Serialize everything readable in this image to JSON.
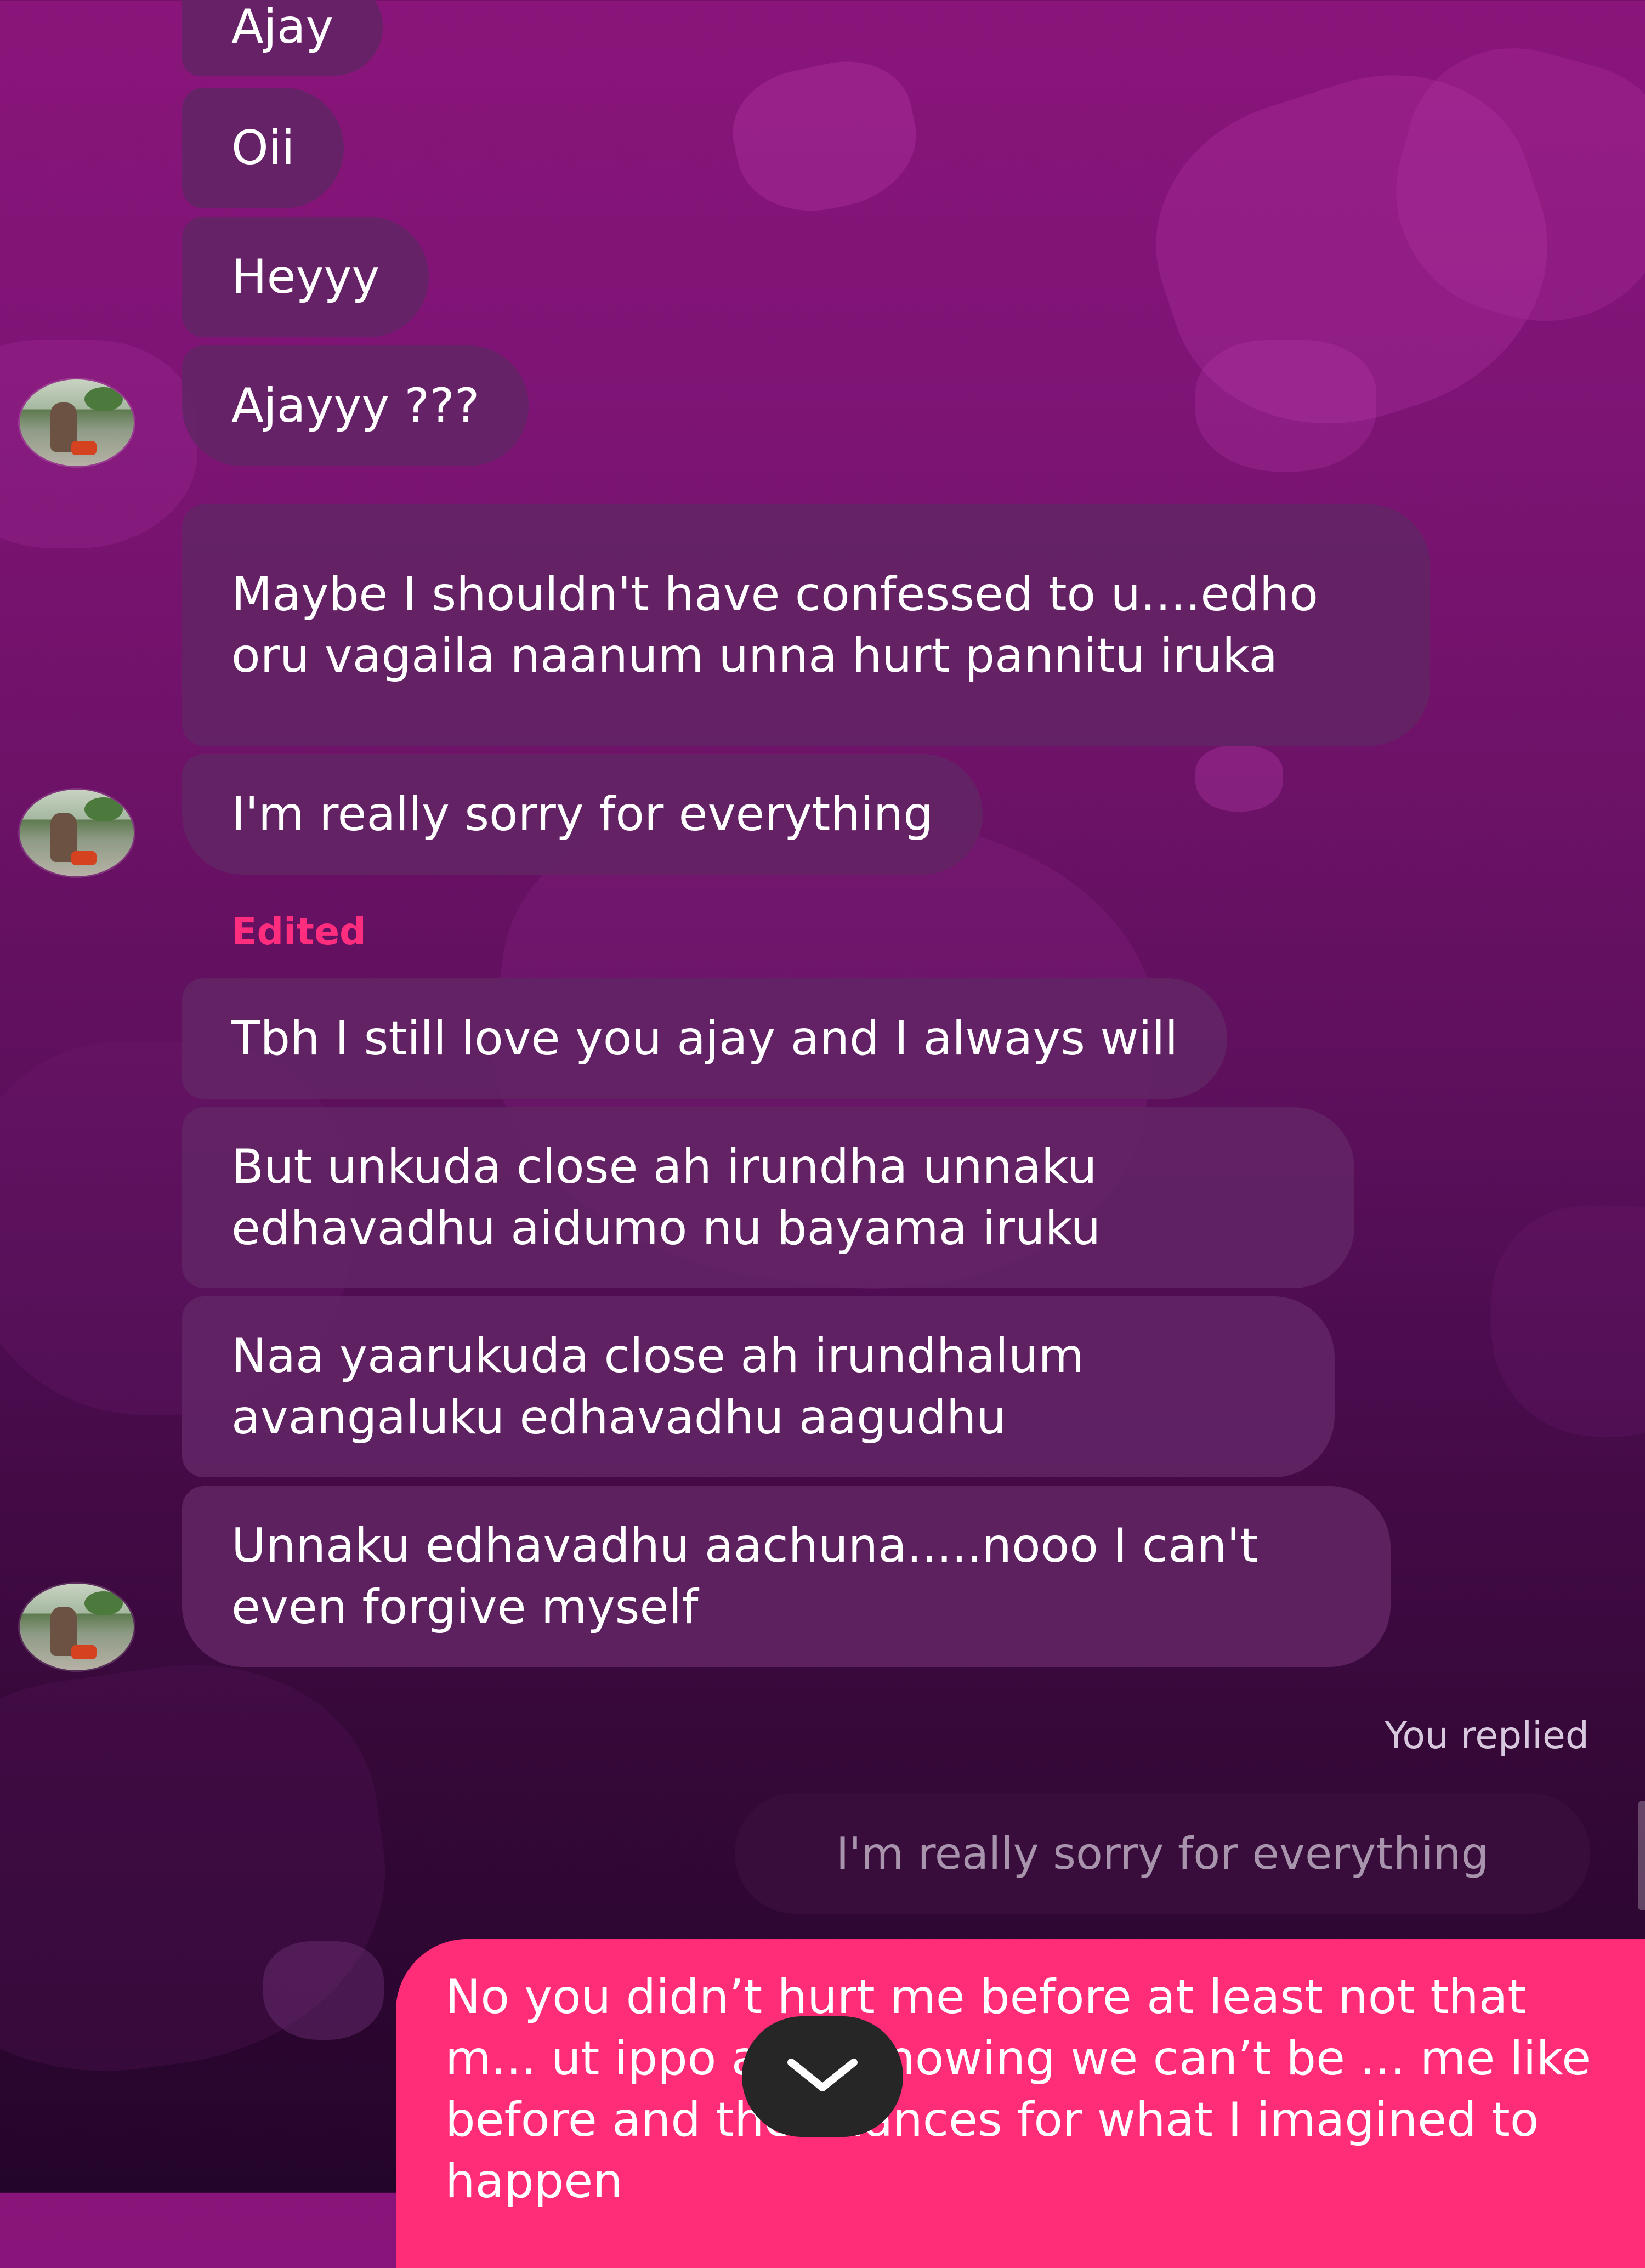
{
  "messages": [
    {
      "text": "Ajay"
    },
    {
      "text": "Oii"
    },
    {
      "text": "Heyyy"
    },
    {
      "text": "Ajayyy ???"
    },
    {
      "text": "Maybe I shouldn't have confessed to u....edho oru vagaila naanum unna hurt pannitu iruka"
    },
    {
      "text": "I'm really sorry for everything"
    },
    {
      "text": "Tbh I still love you ajay and I always will"
    },
    {
      "text": "But unkuda close ah irundha unnaku edhavadhu aidumo nu bayama iruku"
    },
    {
      "text": "Naa yaarukuda close ah irundhalum avangaluku edhavadhu aagudhu"
    },
    {
      "text": "Unnaku edhavadhu aachuna.....nooo I can't even forgive myself"
    }
  ],
  "edited_label": "Edited",
  "reply": {
    "label": "You replied",
    "quoted_text": "I'm really sorry for everything",
    "text": "No you didn’t hurt me before at least not that m... ut ippo after knowing we can’t be ... me like before and the chances for what I imagined to happen"
  },
  "icons": {
    "scroll_down": "chevron-down-icon",
    "avatar": "avatar"
  },
  "colors": {
    "incoming_bubble": "#622464",
    "outgoing_bubble": "#ff2d78",
    "edited": "#ff2d7e"
  }
}
